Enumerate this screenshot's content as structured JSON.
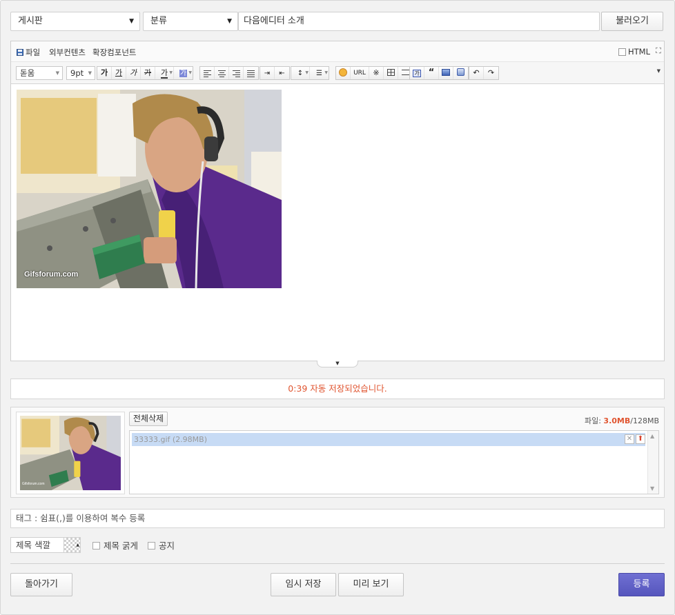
{
  "form": {
    "board_select": "게시판",
    "category_select": "분류",
    "title_value": "다음에디터 소개",
    "load_button": "불러오기"
  },
  "editor": {
    "menu": {
      "file": "파일",
      "external": "외부컨텐츠",
      "extension": "확장컴포넌트",
      "html": "HTML"
    },
    "toolbar": {
      "font": "돋움",
      "size": "9pt",
      "ga": "가",
      "url": "URL",
      "special_char": "※",
      "quote": "“"
    },
    "image_watermark": "Gifsforum.com"
  },
  "autosave": "0:39 자동 저장되었습니다.",
  "attachments": {
    "delete_all": "전체삭제",
    "quota_label": "파일: ",
    "quota_used": "3.0MB",
    "quota_total": "/128MB",
    "files": [
      {
        "name": "33333.gif (2.98MB)"
      }
    ],
    "thumb_watermark": "Gifsforum.com"
  },
  "tag_placeholder": "태그 : 쉼표(,)를 이용하여 복수 등록",
  "options": {
    "title_color": "제목 색깔",
    "bold_title": "제목 굵게",
    "notice": "공지"
  },
  "actions": {
    "back": "돌아가기",
    "temp_save": "임시 저장",
    "preview": "미리 보기",
    "submit": "등록"
  }
}
